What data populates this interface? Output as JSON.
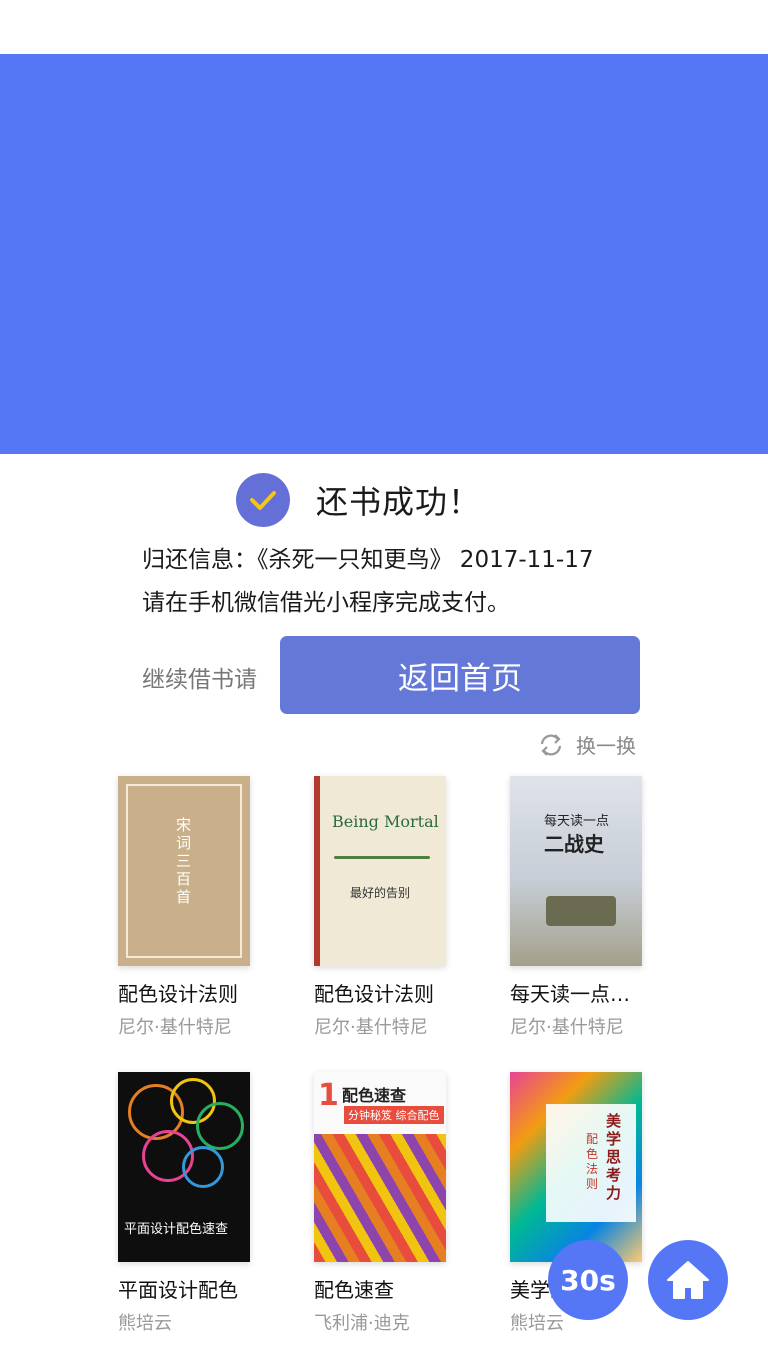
{
  "banner": {
    "color": "#5577f6"
  },
  "status": {
    "title": "还书成功！",
    "return_info": "归还信息：《杀死一只知更鸟》 2017-11-17",
    "pay_note": "请在手机微信借光小程序完成支付。"
  },
  "actions": {
    "continue_label": "继续借书请",
    "home_button": "返回首页",
    "refresh_label": "换一换"
  },
  "books": [
    {
      "title": "配色设计法则",
      "author": "尼尔·基什特尼",
      "cover_text": "宋词三百首"
    },
    {
      "title": "配色设计法则",
      "author": "尼尔·基什特尼",
      "cover_text": "Being Mortal",
      "cover_sub": "最好的告别"
    },
    {
      "title": "每天读一点二战史",
      "author": "尼尔·基什特尼",
      "cover_text": "二战史",
      "cover_top": "每天读一点"
    },
    {
      "title": "平面设计配色",
      "author": "熊培云",
      "cover_text": "平面设计配色速查"
    },
    {
      "title": "配色速查",
      "author": "飞利浦·迪克",
      "cover_text": "配色速查",
      "cover_sub": "分钟秘笈 综合配色",
      "cover_num": "1"
    },
    {
      "title": "美学思考力",
      "author": "熊培云",
      "cover_text": "美学思考力",
      "cover_sub": "配色法则"
    }
  ],
  "timer": "30s",
  "colors": {
    "accent": "#5577f6",
    "button": "#6478d8",
    "check": "#f5c518"
  }
}
